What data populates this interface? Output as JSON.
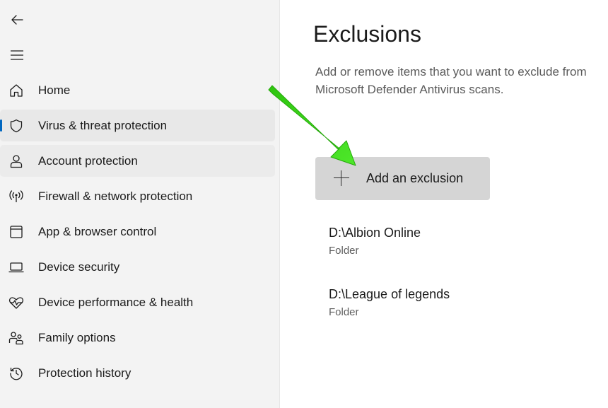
{
  "sidebar": {
    "items": [
      {
        "label": "Home",
        "icon": "home-icon"
      },
      {
        "label": "Virus & threat protection",
        "icon": "shield-icon"
      },
      {
        "label": "Account protection",
        "icon": "person-icon"
      },
      {
        "label": "Firewall & network protection",
        "icon": "antenna-icon"
      },
      {
        "label": "App & browser control",
        "icon": "app-window-icon"
      },
      {
        "label": "Device security",
        "icon": "laptop-icon"
      },
      {
        "label": "Device performance & health",
        "icon": "heart-pulse-icon"
      },
      {
        "label": "Family options",
        "icon": "family-icon"
      },
      {
        "label": "Protection history",
        "icon": "history-icon"
      }
    ],
    "selected": "Virus & threat protection"
  },
  "main": {
    "title": "Exclusions",
    "description": "Add or remove items that you want to exclude from Microsoft Defender Antivirus scans.",
    "add_button_label": "Add an exclusion",
    "exclusions": [
      {
        "path": "D:\\Albion Online",
        "type": "Folder"
      },
      {
        "path": "D:\\League of legends",
        "type": "Folder"
      }
    ]
  },
  "colors": {
    "accent": "#0067c0",
    "annotation_arrow": "#3ddc1f"
  }
}
